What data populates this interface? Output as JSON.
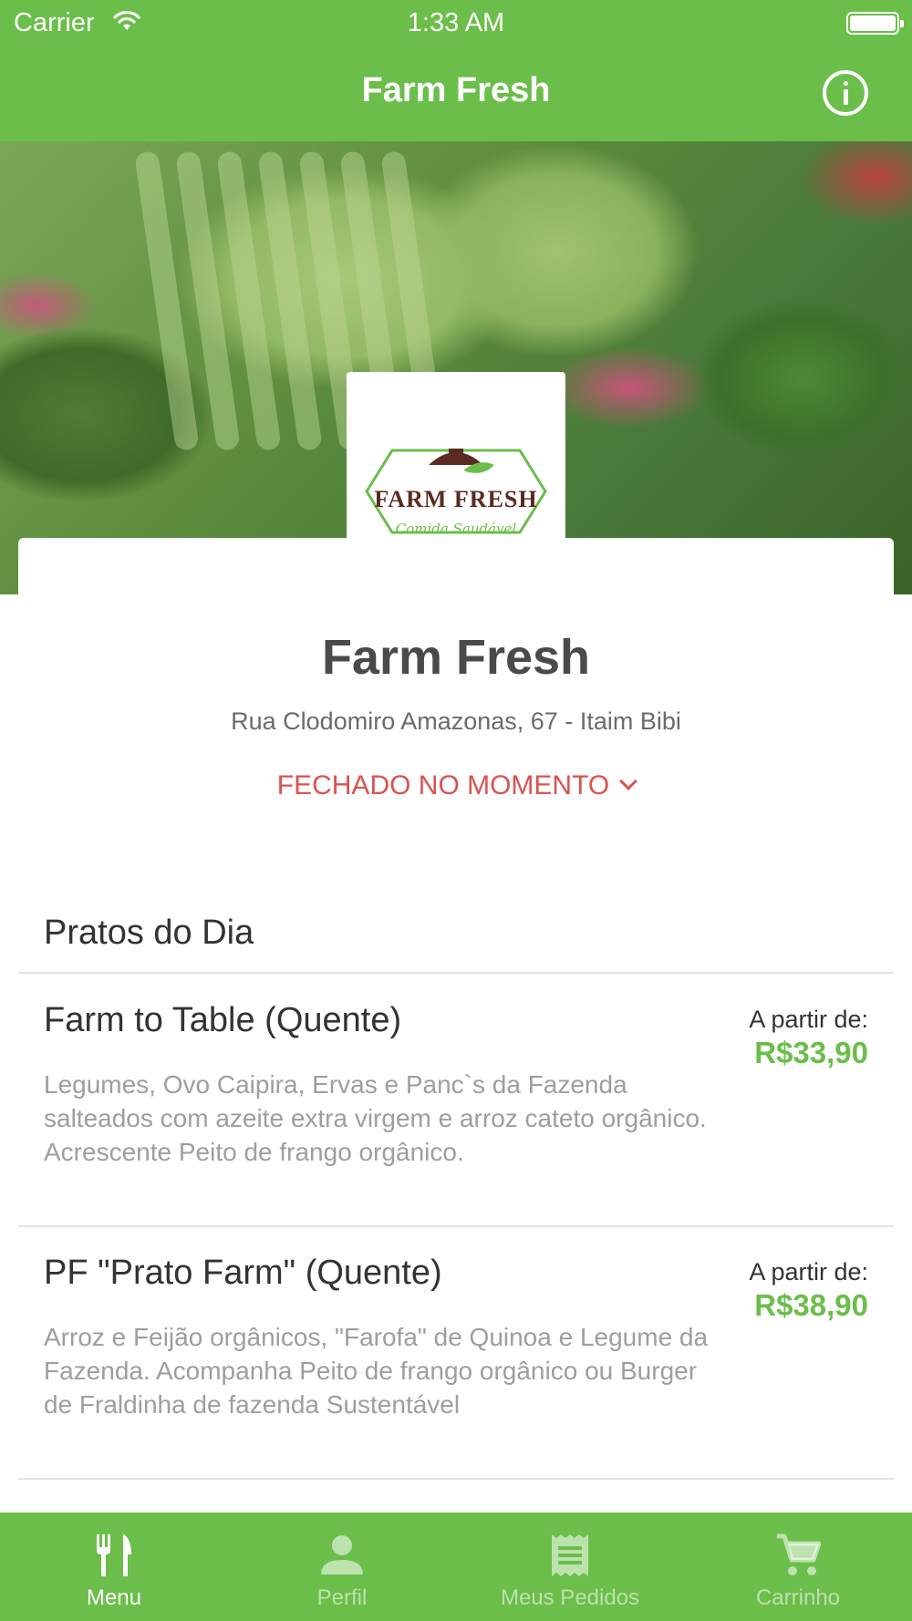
{
  "status_bar": {
    "carrier": "Carrier",
    "time": "1:33 AM"
  },
  "nav": {
    "title": "Farm Fresh",
    "info_icon": "info-icon"
  },
  "logo": {
    "text": "FARM FRESH",
    "tagline": "Comida Saudável"
  },
  "restaurant": {
    "name": "Farm Fresh",
    "address": "Rua Clodomiro Amazonas, 67 - Itaim Bibi",
    "status": "FECHADO NO MOMENTO"
  },
  "menu": {
    "section_title": "Pratos do Dia",
    "items": [
      {
        "name": "Farm to Table (Quente)",
        "description": "Legumes, Ovo Caipira, Ervas e Panc`s da Fazenda salteados com azeite extra virgem e arroz cateto orgânico. Acrescente Peito de frango orgânico.",
        "from_label": "A partir de:",
        "price": "R$33,90"
      },
      {
        "name": "PF \"Prato Farm\" (Quente)",
        "description": "Arroz e Feijão orgânicos, \"Farofa\" de Quinoa e Legume da Fazenda. Acompanha Peito de frango orgânico ou Burger de Fraldinha de fazenda Sustentável",
        "from_label": "A partir de:",
        "price": "R$38,90"
      }
    ]
  },
  "tabbar": {
    "active": "Menu",
    "tabs": [
      {
        "label": "Menu",
        "icon": "fork-knife-icon"
      },
      {
        "label": "Perfil",
        "icon": "person-icon"
      },
      {
        "label": "Meus Pedidos",
        "icon": "receipt-icon"
      },
      {
        "label": "Carrinho",
        "icon": "cart-icon"
      }
    ]
  },
  "colors": {
    "brand_green": "#6bbe4a",
    "closed_red": "#d9534f"
  }
}
